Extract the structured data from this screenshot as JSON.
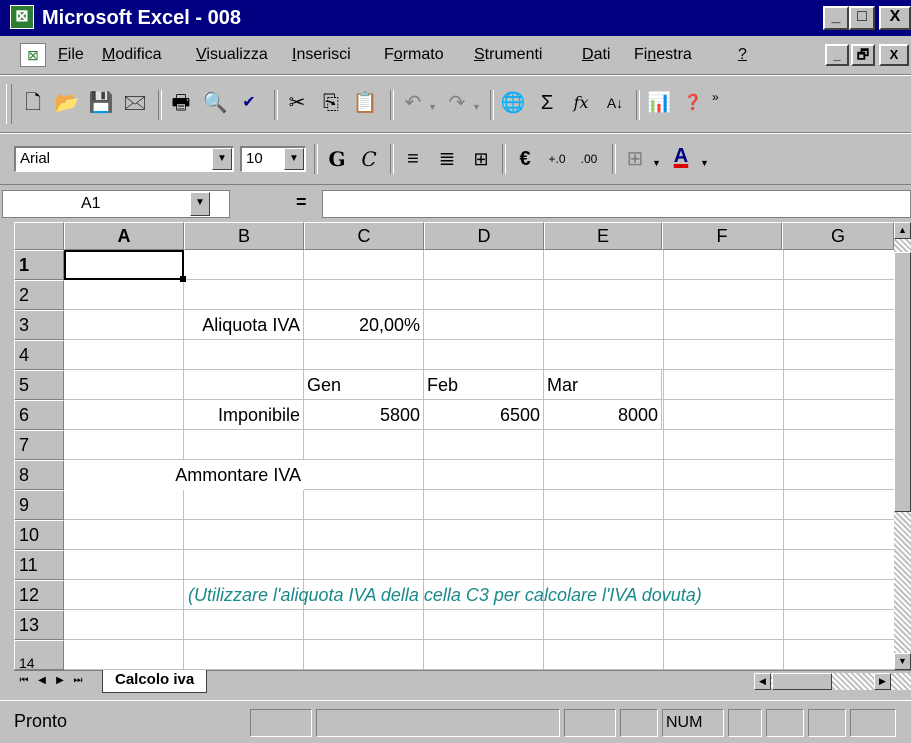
{
  "window": {
    "title": "Microsoft Excel - 008",
    "icon": "excel-icon"
  },
  "window_controls": [
    "_",
    "□",
    "X"
  ],
  "doc_controls": [
    "_",
    "🗗",
    "X"
  ],
  "menu": [
    {
      "label": "File",
      "key": "F",
      "rest": "ile"
    },
    {
      "label": "Modifica",
      "key": "M",
      "rest": "odifica"
    },
    {
      "label": "Visualizza",
      "key": "V",
      "rest": "isualizza"
    },
    {
      "label": "Inserisci",
      "key": "I",
      "rest": "nserisci"
    },
    {
      "label": "Formato",
      "pre": "F",
      "key": "o",
      "rest": "rmato"
    },
    {
      "label": "Strumenti",
      "key": "S",
      "rest": "trumenti"
    },
    {
      "label": "Dati",
      "key": "D",
      "rest": "ati"
    },
    {
      "label": "Finestra",
      "pre": "Fi",
      "key": "n",
      "rest": "estra"
    },
    {
      "label": "?",
      "key": "?",
      "rest": ""
    }
  ],
  "formatting": {
    "font": "Arial",
    "size": "10",
    "bold": "G",
    "italic": "C",
    "euro": "€",
    "font_color": "A"
  },
  "formula_bar": {
    "name_box": "A1",
    "equals": "="
  },
  "columns": [
    "A",
    "B",
    "C",
    "D",
    "E",
    "F",
    "G"
  ],
  "rows": [
    "1",
    "2",
    "3",
    "4",
    "5",
    "6",
    "7",
    "8",
    "9",
    "10",
    "11",
    "12",
    "13",
    "14"
  ],
  "cells": {
    "B3": "Aliquota IVA",
    "C3": "20,00%",
    "C5": "Gen",
    "D5": "Feb",
    "E5": "Mar",
    "B6": "Imponibile",
    "C6": "5800",
    "D6": "6500",
    "E6": "8000",
    "B8": "Ammontare IVA",
    "B12": "(Utilizzare l'aliquota IVA della cella C3 per calcolare l'IVA dovuta)"
  },
  "sheet_tab": "Calcolo iva",
  "status": {
    "text": "Pronto",
    "num": "NUM"
  }
}
